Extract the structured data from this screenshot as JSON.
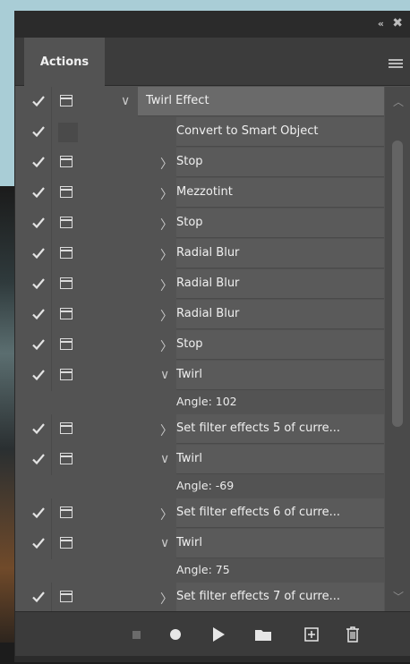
{
  "panel": {
    "tab_label": "Actions",
    "collapse_glyph": "«",
    "close_glyph": "✖"
  },
  "rows": [
    {
      "type": "action",
      "label": "Twirl Effect",
      "arrow": "∨",
      "checked": true,
      "dialog": true
    },
    {
      "type": "step",
      "label": "Convert to Smart Object",
      "arrow": "",
      "checked": true,
      "dialog": false
    },
    {
      "type": "step",
      "label": "Stop",
      "arrow": "〉",
      "checked": true,
      "dialog": true
    },
    {
      "type": "step",
      "label": "Mezzotint",
      "arrow": "〉",
      "checked": true,
      "dialog": true
    },
    {
      "type": "step",
      "label": "Stop",
      "arrow": "〉",
      "checked": true,
      "dialog": true
    },
    {
      "type": "step",
      "label": "Radial Blur",
      "arrow": "〉",
      "checked": true,
      "dialog": true
    },
    {
      "type": "step",
      "label": "Radial Blur",
      "arrow": "〉",
      "checked": true,
      "dialog": true
    },
    {
      "type": "step",
      "label": "Radial Blur",
      "arrow": "〉",
      "checked": true,
      "dialog": true
    },
    {
      "type": "step",
      "label": "Stop",
      "arrow": "〉",
      "checked": true,
      "dialog": true
    },
    {
      "type": "step",
      "label": "Twirl",
      "arrow": "∨",
      "checked": true,
      "dialog": true
    },
    {
      "type": "sub",
      "label": "Angle: 102"
    },
    {
      "type": "step",
      "label": "Set filter effects 5 of curre...",
      "arrow": "〉",
      "checked": true,
      "dialog": true
    },
    {
      "type": "step",
      "label": "Twirl",
      "arrow": "∨",
      "checked": true,
      "dialog": true
    },
    {
      "type": "sub",
      "label": "Angle: -69"
    },
    {
      "type": "step",
      "label": "Set filter effects 6 of curre...",
      "arrow": "〉",
      "checked": true,
      "dialog": true
    },
    {
      "type": "step",
      "label": "Twirl",
      "arrow": "∨",
      "checked": true,
      "dialog": true
    },
    {
      "type": "sub",
      "label": "Angle: 75"
    },
    {
      "type": "step",
      "label": "Set filter effects 7 of curre...",
      "arrow": "〉",
      "checked": true,
      "dialog": true
    },
    {
      "type": "step",
      "label": "",
      "arrow": "",
      "checked": false,
      "dialog": true
    }
  ],
  "toolbar": {
    "buttons": [
      {
        "name": "stop-playing-button",
        "icon": "stop-icon"
      },
      {
        "name": "begin-recording-button",
        "icon": "record-icon"
      },
      {
        "name": "play-selection-button",
        "icon": "play-icon"
      },
      {
        "name": "create-new-set-button",
        "icon": "folder-icon"
      },
      {
        "name": "create-new-action-button",
        "icon": "new-item-icon"
      },
      {
        "name": "delete-button",
        "icon": "trash-icon"
      }
    ]
  }
}
